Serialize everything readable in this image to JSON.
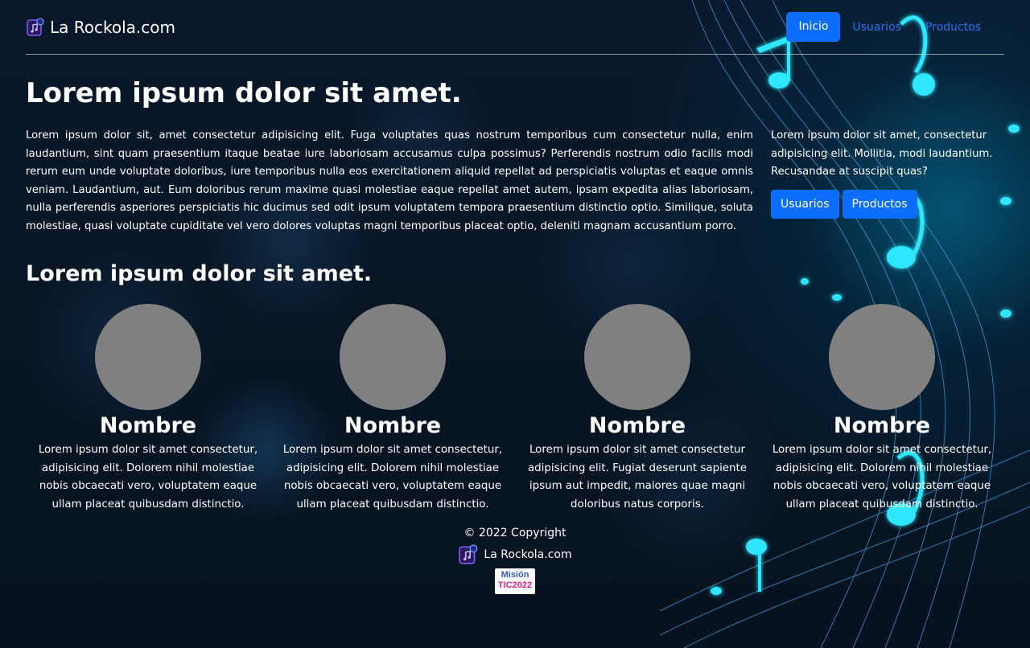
{
  "navbar": {
    "brand": "La Rockola.com",
    "links": [
      {
        "label": "Inicio",
        "active": true
      },
      {
        "label": "Usuarios",
        "active": false
      },
      {
        "label": "Productos",
        "active": false
      }
    ]
  },
  "hero": {
    "title": "Lorem ipsum dolor sit amet.",
    "text": "Lorem ipsum dolor sit, amet consectetur adipisicing elit. Fuga voluptates quas nostrum temporibus cum consectetur nulla, enim laudantium, sint quam praesentium itaque beatae iure laboriosam accusamus culpa possimus? Perferendis nostrum odio facilis modi rerum eum unde voluptate doloribus, iure temporibus nulla eos exercitationem aliquid repellat ad perspiciatis voluptas et eaque omnis veniam. Laudantium, aut. Eum doloribus rerum maxime quasi molestiae eaque repellat amet autem, ipsam expedita alias laboriosam, nulla perferendis asperiores perspiciatis hic ducimus sed odit ipsum voluptatem tempora praesentium distinctio optio. Similique, soluta molestiae, quasi voluptate cupiditate vel vero dolores voluptas magni temporibus placeat optio, deleniti magnam accusantium porro.",
    "side_text": "Lorem ipsum dolor sit amet, consectetur adipisicing elit. Mollitia, modi laudantium. Recusandae at suscipit quas?",
    "buttons": [
      "Usuarios",
      "Productos"
    ]
  },
  "team": {
    "title": "Lorem ipsum dolor sit amet.",
    "members": [
      {
        "name": "Nombre",
        "text": "Lorem ipsum dolor sit amet consectetur, adipisicing elit. Dolorem nihil molestiae nobis obcaecati vero, voluptatem eaque ullam placeat quibusdam distinctio."
      },
      {
        "name": "Nombre",
        "text": "Lorem ipsum dolor sit amet consectetur, adipisicing elit. Dolorem nihil molestiae nobis obcaecati vero, voluptatem eaque ullam placeat quibusdam distinctio."
      },
      {
        "name": "Nombre",
        "text": "Lorem ipsum dolor sit amet consectetur adipisicing elit. Fugiat deserunt sapiente ipsum aut impedit, maiores quae magni doloribus natus corporis."
      },
      {
        "name": "Nombre",
        "text": "Lorem ipsum dolor sit amet consectetur, adipisicing elit. Dolorem nihil molestiae nobis obcaecati vero, voluptatem eaque ullam placeat quibusdam distinctio."
      }
    ]
  },
  "footer": {
    "copyright": "© 2022 Copyright",
    "brand": "La Rockola.com",
    "mision_line1": "Misión",
    "mision_line2": "TIC2022"
  },
  "colors": {
    "primary": "#0d6efd",
    "link": "#2f6ef0",
    "avatar": "#808080",
    "accent_neon": "#2ee6ff"
  },
  "icons": {
    "brand_logo": "music-file-icon"
  }
}
